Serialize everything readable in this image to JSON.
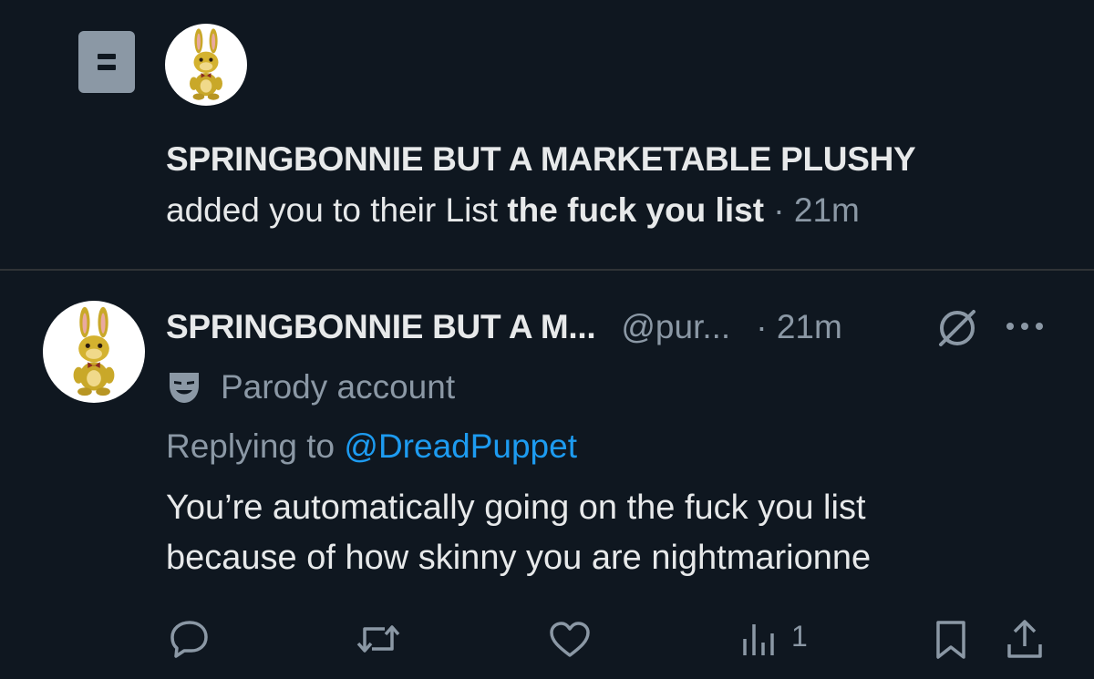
{
  "notification": {
    "icon": "list-icon",
    "account_name": "SPRINGBONNIE BUT A MARKETABLE PLUSHY",
    "action_text": "added you to their List",
    "list_name": "the fuck you list",
    "separator": "·",
    "time": "21m"
  },
  "post": {
    "display_name": "SPRINGBONNIE BUT A M...",
    "handle": "@pur...",
    "separator": "·",
    "time": "21m",
    "badge_icon": "no-sign-icon",
    "more_icon": "more-icon",
    "label_icon": "theater-mask-icon",
    "label": "Parody account",
    "replying_prefix": "Replying to",
    "replying_to": "@DreadPuppet",
    "text_lines": [
      "You’re automatically going on the fuck you list",
      "because of how skinny you are nightmarionne"
    ],
    "actions": {
      "reply_icon": "reply-icon",
      "repost_icon": "repost-icon",
      "like_icon": "heart-icon",
      "views_icon": "views-icon",
      "views_count": "1",
      "bookmark_icon": "bookmark-icon",
      "share_icon": "share-icon"
    }
  },
  "colors": {
    "background": "#0f1720",
    "text_primary": "#e7e9ea",
    "text_muted": "#8b98a5",
    "link": "#1d9bf0",
    "divider": "#2f3336"
  }
}
